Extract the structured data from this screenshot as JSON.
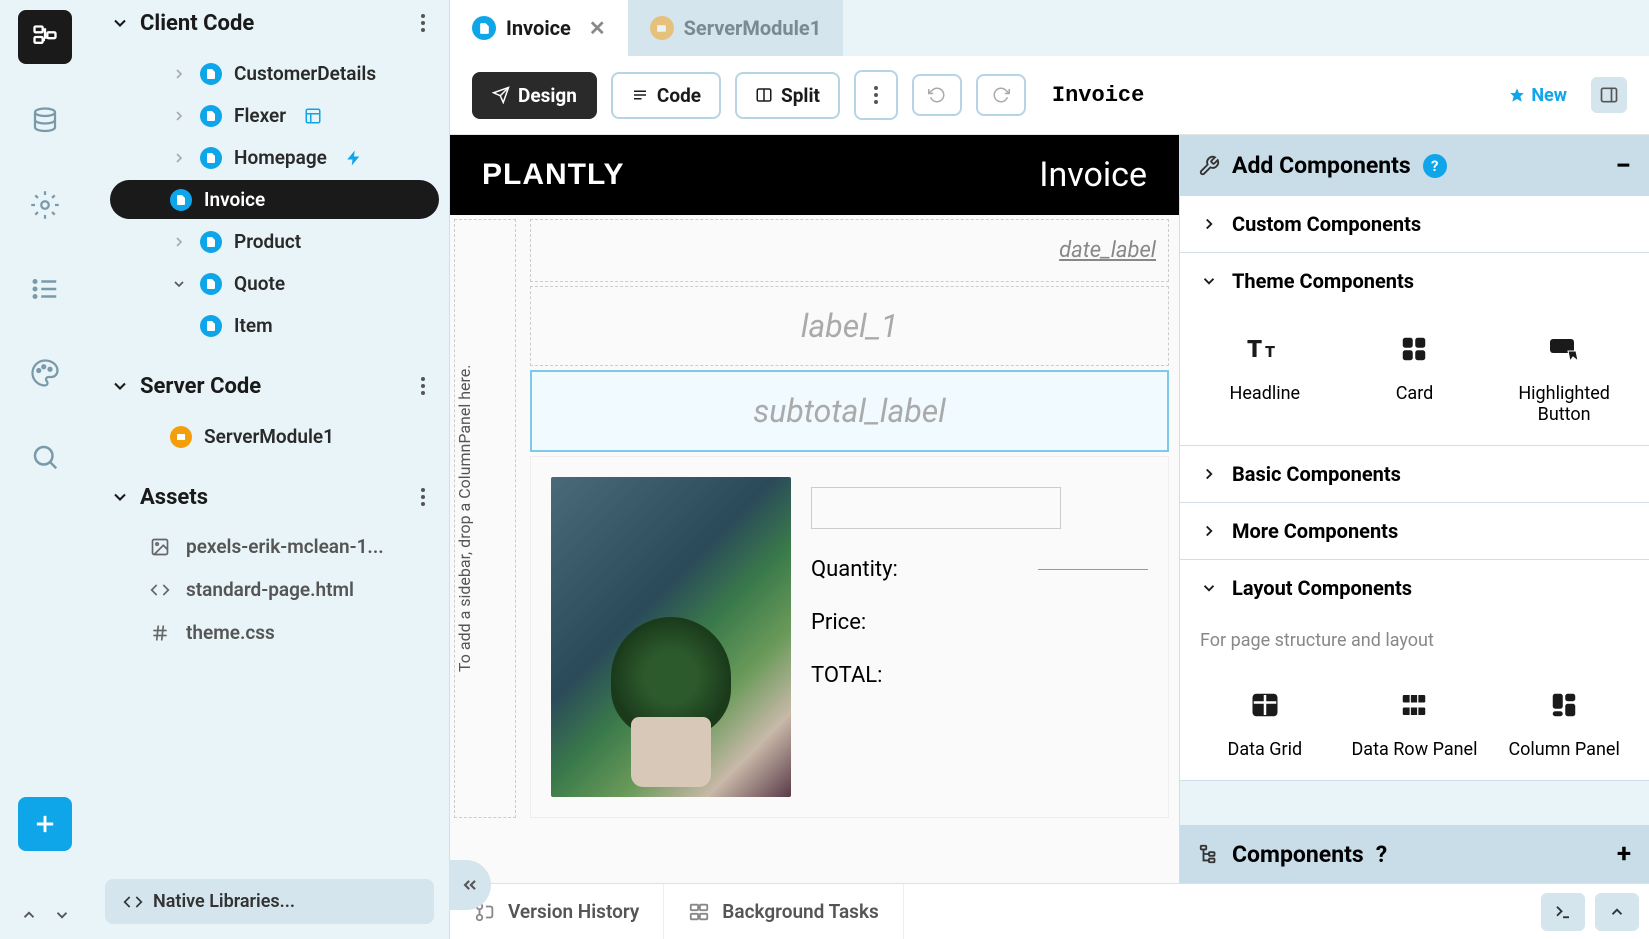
{
  "sidebar_sections": {
    "client_code": "Client Code",
    "server_code": "Server Code",
    "assets": "Assets"
  },
  "client_items": [
    {
      "label": "CustomerDetails",
      "active": false,
      "extra": null
    },
    {
      "label": "Flexer",
      "active": false,
      "extra": "wand"
    },
    {
      "label": "Homepage",
      "active": false,
      "extra": "bolt"
    },
    {
      "label": "Invoice",
      "active": true,
      "extra": null
    },
    {
      "label": "Product",
      "active": false,
      "extra": null
    },
    {
      "label": "Quote",
      "active": false,
      "extra": null,
      "expandable": true
    }
  ],
  "quote_children": [
    {
      "label": "Item"
    }
  ],
  "server_items": [
    {
      "label": "ServerModule1"
    }
  ],
  "asset_items": [
    {
      "label": "pexels-erik-mclean-1...",
      "icon": "image"
    },
    {
      "label": "standard-page.html",
      "icon": "code"
    },
    {
      "label": "theme.css",
      "icon": "hash"
    }
  ],
  "native_libraries": "Native Libraries...",
  "tabs": [
    {
      "label": "Invoice",
      "active": true
    },
    {
      "label": "ServerModule1",
      "active": false
    }
  ],
  "toolbar": {
    "design": "Design",
    "code": "Code",
    "split": "Split",
    "title": "Invoice",
    "new": "New"
  },
  "form": {
    "logo": "PLANTLY",
    "header_title": "Invoice",
    "sidebar_hint": "To add a sidebar, drop a ColumnPanel here.",
    "date_label": "date_label",
    "label_1": "label_1",
    "subtotal_label": "subtotal_label",
    "quantity": "Quantity:",
    "price": "Price:",
    "total": "TOTAL:"
  },
  "right_panel": {
    "add_components": "Add Components",
    "components_footer": "Components",
    "sections": {
      "custom": "Custom Components",
      "theme": "Theme Components",
      "basic": "Basic Components",
      "more": "More Components",
      "layout": "Layout Components"
    },
    "layout_hint": "For page structure and layout",
    "theme_items": [
      {
        "label": "Headline"
      },
      {
        "label": "Card"
      },
      {
        "label": "Highlighted Button"
      }
    ],
    "layout_items": [
      {
        "label": "Data Grid"
      },
      {
        "label": "Data Row Panel"
      },
      {
        "label": "Column Panel"
      }
    ]
  },
  "bottom": {
    "version_history": "Version History",
    "background_tasks": "Background Tasks"
  }
}
